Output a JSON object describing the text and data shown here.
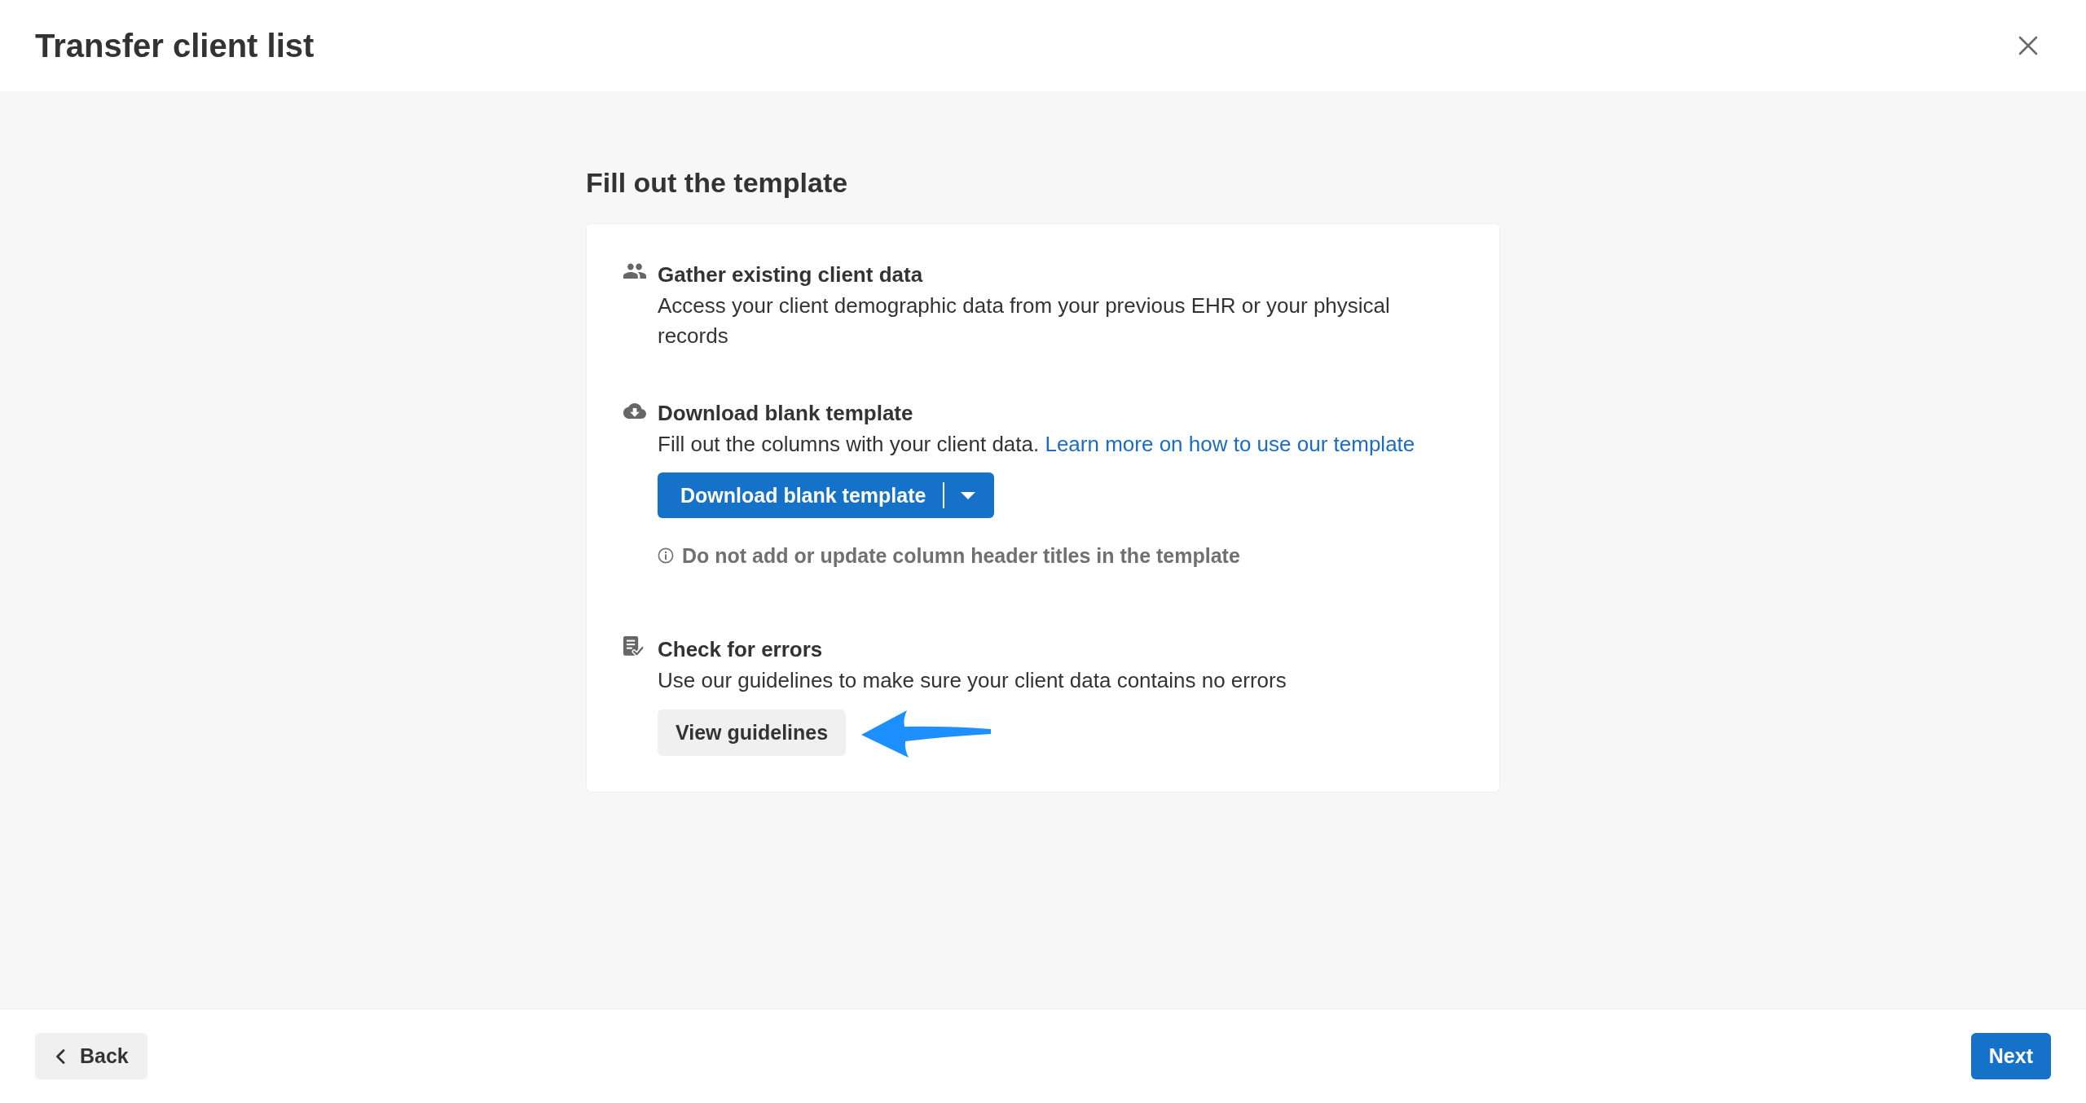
{
  "window": {
    "title": "Transfer client list"
  },
  "section": {
    "title": "Fill out the template",
    "steps": [
      {
        "kind": "gather",
        "title": "Gather existing client data",
        "description": "Access your client demographic data from your previous EHR or your physical records",
        "annotated": false
      },
      {
        "kind": "download",
        "title": "Download blank template",
        "description": "Fill out the columns with your client data.",
        "link": "Learn more on how to use our template",
        "button": {
          "kind": "split",
          "label": "Download blank template"
        },
        "note": "Do not add or update column header titles in the template",
        "annotated": false
      },
      {
        "kind": "check",
        "title": "Check for errors",
        "description": "Use our guidelines to make sure your client data contains no errors",
        "button": {
          "kind": "secondary",
          "label": "View guidelines"
        },
        "annotated": true
      }
    ]
  },
  "footer": {
    "buttons": [
      {
        "kind": "back",
        "label": "Back"
      },
      {
        "kind": "primary",
        "label": "Next"
      }
    ]
  }
}
